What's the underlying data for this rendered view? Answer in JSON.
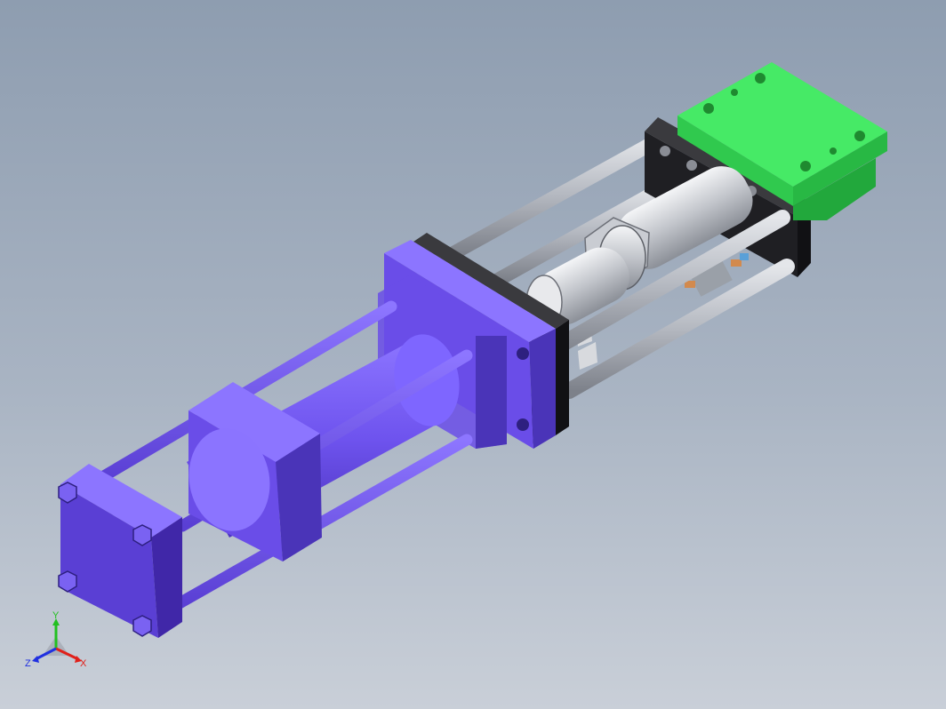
{
  "triad": {
    "x_label": "X",
    "y_label": "Y",
    "z_label": "Z",
    "x_color": "#e0201a",
    "y_color": "#22c020",
    "z_color": "#2030e0"
  },
  "colors": {
    "cylinder": "#6a4de8",
    "cylinder_dark": "#4a34b8",
    "green_block": "#3be05a",
    "plate": "#2a2a2e",
    "rod": "#b9bcc4"
  }
}
